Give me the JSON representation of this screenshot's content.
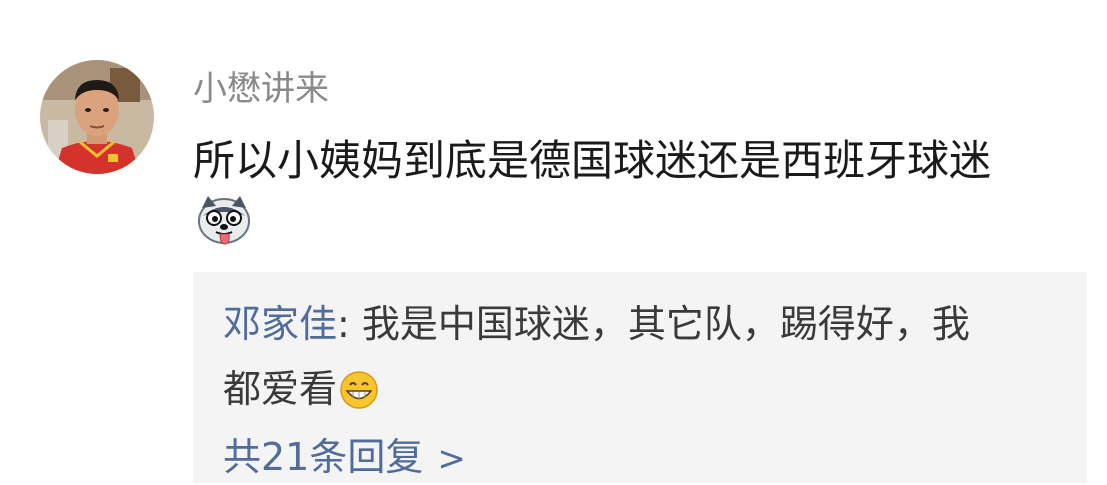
{
  "comment": {
    "username": "小懋讲来",
    "text": "所以小姨妈到底是德国球迷还是西班牙球迷",
    "emoji": "husky-tongue-emoji"
  },
  "reply": {
    "author": "邓家佳",
    "separator": ": ",
    "text_line1": "我是中国球迷，其它队，踢得好，我",
    "text_line2": "都爱看",
    "emoji": "grinning-face-emoji"
  },
  "reply_summary": {
    "label": "共21条回复",
    "chevron": ">"
  },
  "colors": {
    "username": "#8a8a8a",
    "link": "#4f6c9b",
    "text": "#1a1a1a",
    "reply_bg": "#f4f4f4"
  }
}
